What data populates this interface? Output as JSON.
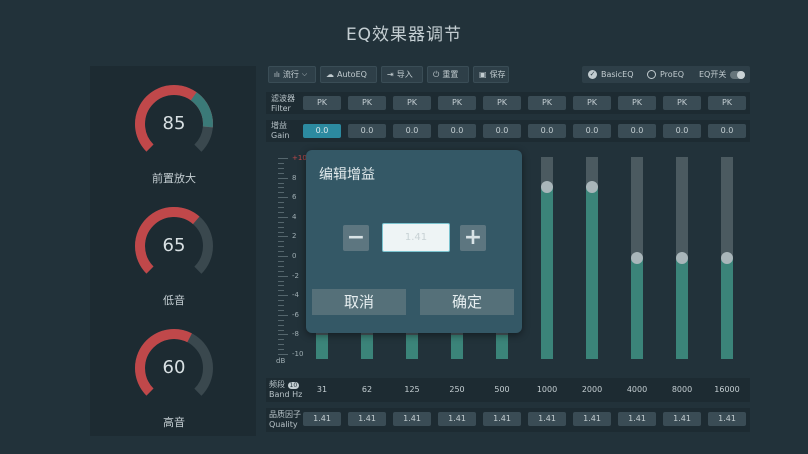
{
  "title": "EQ效果器调节",
  "knobs": [
    {
      "value": "85",
      "label": "前置放大",
      "level": 0.85
    },
    {
      "value": "65",
      "label": "低音",
      "level": 0.65
    },
    {
      "value": "60",
      "label": "高音",
      "level": 0.6
    }
  ],
  "toolbar": {
    "preset_label": "流行",
    "autoeq_label": "AutoEQ",
    "import_label": "导入",
    "reset_label": "重置",
    "save_label": "保存",
    "basiceq_label": "BasicEQ",
    "proeq_label": "ProEQ",
    "eq_switch_label": "EQ开关",
    "selected_mode": "BasicEQ",
    "eq_switch_on": false
  },
  "filter_row": {
    "label_cn": "滤波器",
    "label_en": "Filter",
    "values": [
      "PK",
      "PK",
      "PK",
      "PK",
      "PK",
      "PK",
      "PK",
      "PK",
      "PK",
      "PK"
    ]
  },
  "gain_row": {
    "label_cn": "增益",
    "label_en": "Gain",
    "values": [
      "0.0",
      "0.0",
      "0.0",
      "0.0",
      "0.0",
      "0.0",
      "0.0",
      "0.0",
      "0.0",
      "0.0"
    ],
    "selected_index": 0
  },
  "scale": {
    "labels": [
      "+10",
      "8",
      "6",
      "4",
      "2",
      "0",
      "-2",
      "-4",
      "-6",
      "-8",
      "-10"
    ],
    "unit": "dB"
  },
  "bands": {
    "label_cn": "频段",
    "badge": "10",
    "label_en": "Band Hz",
    "freqs": [
      "31",
      "62",
      "125",
      "250",
      "500",
      "1000",
      "2000",
      "4000",
      "8000",
      "16000"
    ],
    "levels": [
      0.0,
      0.0,
      0.0,
      0.0,
      0.0,
      0.85,
      0.85,
      0.5,
      0.5,
      0.5
    ]
  },
  "quality_row": {
    "label_cn": "品质因子",
    "label_en": "Quality",
    "values": [
      "1.41",
      "1.41",
      "1.41",
      "1.41",
      "1.41",
      "1.41",
      "1.41",
      "1.41",
      "1.41",
      "1.41"
    ]
  },
  "dialog": {
    "title": "编辑增益",
    "minus": "−",
    "plus": "+",
    "input_value": "1.41",
    "cancel": "取消",
    "confirm": "确定"
  },
  "colors": {
    "accent_red": "#c0484a",
    "accent_teal": "#3b8479",
    "selected_cell": "#2c8aa0"
  }
}
